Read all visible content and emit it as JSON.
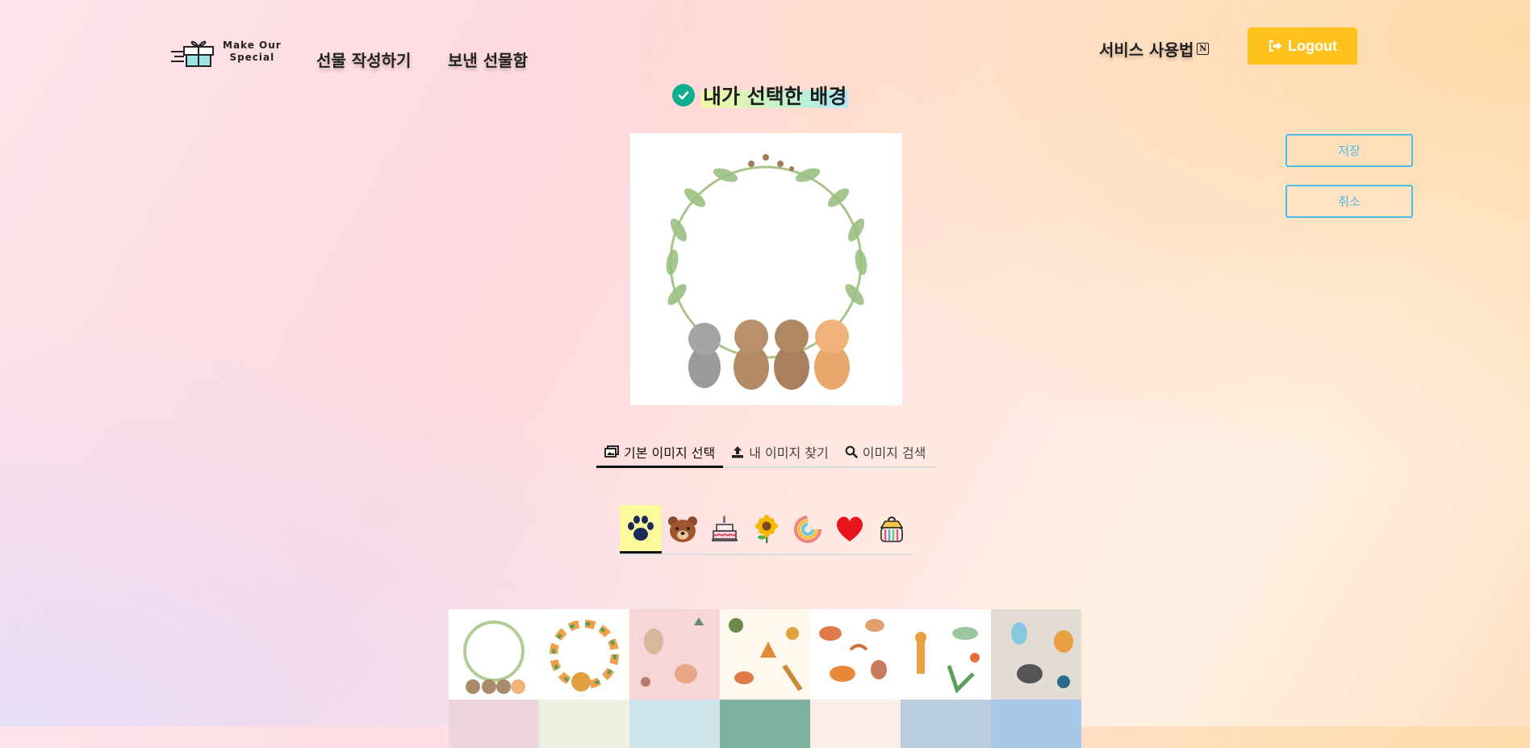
{
  "header": {
    "logo_line1": "Make Our",
    "logo_line2": "Special",
    "nav_write": "선물 작성하기",
    "nav_sent": "보낸 선물함",
    "guide": "서비스 사용법",
    "guide_badge": "N",
    "logout": "Logout"
  },
  "title": "내가 선택한 배경",
  "actions": {
    "save": "저장",
    "cancel": "취소"
  },
  "tabs": [
    {
      "label": "기본 이미지 선택",
      "icon": "images-icon",
      "active": true
    },
    {
      "label": "내 이미지 찾기",
      "icon": "upload-icon",
      "active": false
    },
    {
      "label": "이미지 검색",
      "icon": "search-icon",
      "active": false
    }
  ],
  "categories": [
    {
      "name": "paw-icon",
      "active": true
    },
    {
      "name": "bear-icon",
      "active": false
    },
    {
      "name": "cake-icon",
      "active": false
    },
    {
      "name": "sunflower-icon",
      "active": false
    },
    {
      "name": "rainbow-icon",
      "active": false
    },
    {
      "name": "heart-icon",
      "active": false
    },
    {
      "name": "bag-icon",
      "active": false
    }
  ],
  "colors": {
    "accent": "#fec11e",
    "outline_button": "#4bbde6",
    "check": "#0fae8f",
    "active_category": "#fdfa9e"
  }
}
